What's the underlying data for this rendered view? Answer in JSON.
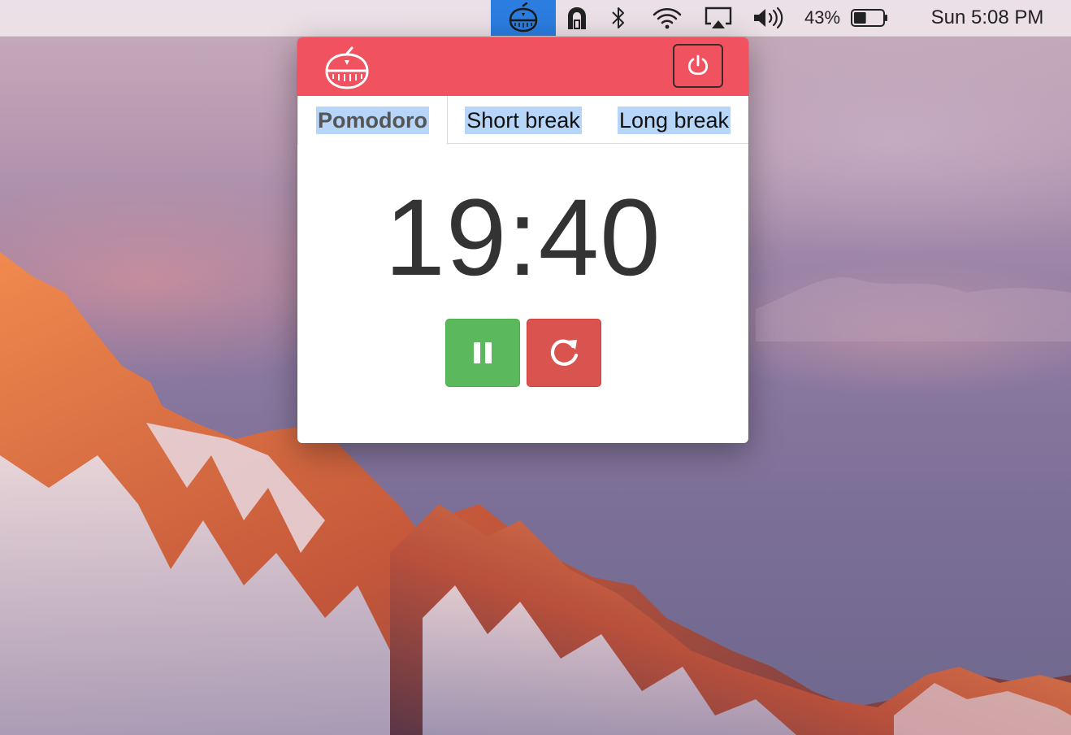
{
  "menubar": {
    "battery_percent": "43%",
    "clock": "Sun 5:08 PM",
    "battery_level": 0.43,
    "icons": {
      "app": "tomato-timer-icon",
      "lock": "lock-icon",
      "bluetooth": "bluetooth-icon",
      "wifi": "wifi-icon",
      "airplay": "airplay-icon",
      "volume": "volume-icon",
      "battery": "battery-icon"
    },
    "active_item_color": "#2b7de0"
  },
  "popover": {
    "header_color": "#f0525f",
    "logo_icon": "tomato-timer-icon",
    "power_icon": "power-icon",
    "tabs": [
      {
        "label": "Pomodoro",
        "active": true
      },
      {
        "label": "Short break",
        "active": false
      },
      {
        "label": "Long break",
        "active": false
      }
    ],
    "timer": "19:40",
    "controls": {
      "pause_icon": "pause-icon",
      "reset_icon": "refresh-icon",
      "pause_color": "#5cb85c",
      "reset_color": "#d9534f"
    }
  }
}
